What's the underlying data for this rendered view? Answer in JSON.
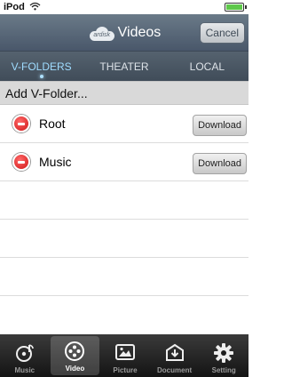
{
  "status_bar": {
    "carrier": "iPod",
    "wifi_icon": "wifi-icon",
    "battery_level": 1.0
  },
  "nav": {
    "logo_text": "ardisk",
    "title": "Videos",
    "cancel_label": "Cancel"
  },
  "tabs": [
    {
      "label": "V-FOLDERS",
      "active": true
    },
    {
      "label": "THEATER",
      "active": false
    },
    {
      "label": "LOCAL",
      "active": false
    }
  ],
  "section": {
    "title": "Add V-Folder..."
  },
  "folders": [
    {
      "name": "Root",
      "action": "Download"
    },
    {
      "name": "Music",
      "action": "Download"
    }
  ],
  "tabbar": [
    {
      "label": "Music",
      "icon": "music-icon",
      "active": false
    },
    {
      "label": "Video",
      "icon": "film-reel-icon",
      "active": true
    },
    {
      "label": "Picture",
      "icon": "picture-icon",
      "active": false
    },
    {
      "label": "Document",
      "icon": "document-icon",
      "active": false
    },
    {
      "label": "Setting",
      "icon": "gear-icon",
      "active": false
    }
  ],
  "colors": {
    "accent_active_tab": "#9fdcff",
    "nav_bar": "#5a6878",
    "delete_red": "#cf1414",
    "battery_green": "#5ec84a"
  }
}
